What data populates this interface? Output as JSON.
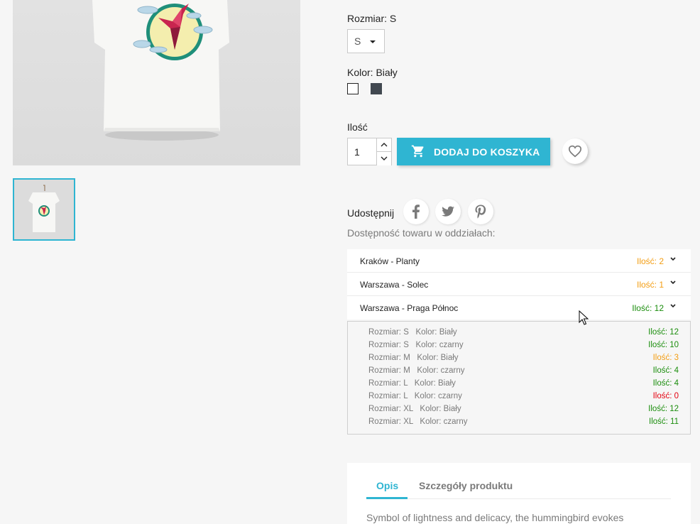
{
  "product": {
    "size_label": "Rozmiar: S",
    "size_selected": "S",
    "color_label": "Kolor: Biały",
    "colors": [
      {
        "name": "Biały",
        "hex": "#ffffff"
      },
      {
        "name": "czarny",
        "hex": "#414850"
      }
    ],
    "quantity_label": "Ilość",
    "quantity_value": "1",
    "add_to_cart_label": "DODAJ DO KOSZYKA",
    "share_label": "Udostępnij",
    "share_icons": [
      "facebook-icon",
      "twitter-icon",
      "pinterest-icon"
    ]
  },
  "availability": {
    "title": "Dostępność towaru w oddziałach:",
    "stores": [
      {
        "name": "Kraków - Planty",
        "qty": "Ilość: 2",
        "status": "orange"
      },
      {
        "name": "Warszawa - Solec",
        "qty": "Ilość: 1",
        "status": "orange"
      },
      {
        "name": "Warszawa - Praga Północ",
        "qty": "Ilość: 12",
        "status": "green"
      }
    ],
    "variants": [
      {
        "label": "Rozmiar: S   Kolor: Biały",
        "qty": "Ilość: 12",
        "status": "green"
      },
      {
        "label": "Rozmiar: S   Kolor: czarny",
        "qty": "Ilość: 10",
        "status": "green"
      },
      {
        "label": "Rozmiar: M   Kolor: Biały",
        "qty": "Ilość: 3",
        "status": "orange"
      },
      {
        "label": "Rozmiar: M   Kolor: czarny",
        "qty": "Ilość: 4",
        "status": "green"
      },
      {
        "label": "Rozmiar: L   Kolor: Biały",
        "qty": "Ilość: 4",
        "status": "green"
      },
      {
        "label": "Rozmiar: L   Kolor: czarny",
        "qty": "Ilość: 0",
        "status": "red"
      },
      {
        "label": "Rozmiar: XL   Kolor: Biały",
        "qty": "Ilość: 12",
        "status": "green"
      },
      {
        "label": "Rozmiar: XL   Kolor: czarny",
        "qty": "Ilość: 11",
        "status": "green"
      }
    ]
  },
  "tabs": [
    {
      "label": "Opis",
      "active": true
    },
    {
      "label": "Szczegóły produktu",
      "active": false
    }
  ],
  "description_preview": "Symbol of lightness and delicacy, the hummingbird evokes",
  "colors": {
    "accent": "#2fb5d2",
    "available": "#1a8d0c",
    "low_stock": "#f39d12",
    "out_of_stock": "#e3000f",
    "background": "#f6f6f6"
  }
}
